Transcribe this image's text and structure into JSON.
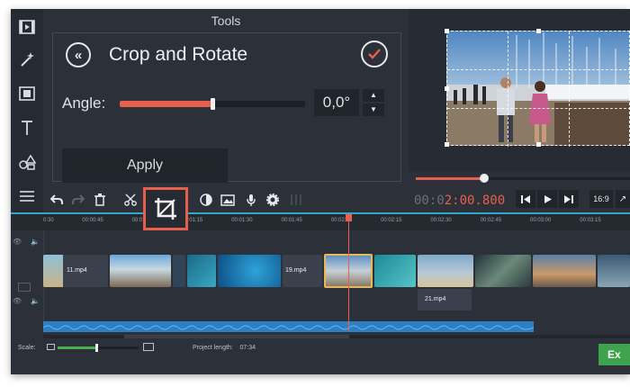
{
  "tools_panel": {
    "header": "Tools",
    "title": "Crop and Rotate",
    "back_icon": "chevron-double-left-icon",
    "confirm_icon": "check-icon",
    "angle_label": "Angle:",
    "angle_value": "0,0°",
    "angle_slider_fraction": 0.5,
    "apply_label": "Apply",
    "accent_color": "#e85f4e"
  },
  "sidebar": {
    "items": [
      {
        "icon": "film-import-icon"
      },
      {
        "icon": "magic-wand-icon"
      },
      {
        "icon": "transitions-icon"
      },
      {
        "icon": "titles-icon"
      },
      {
        "icon": "shapes-icon"
      },
      {
        "icon": "menu-icon"
      }
    ]
  },
  "preview": {
    "seek_fraction": 0.32
  },
  "toolbar": {
    "timecode_dim": "00:0",
    "timecode_active": "2:00.800",
    "aspect_label": "16:9",
    "export_icon": "export-icon"
  },
  "timeline": {
    "ticks": [
      "0:30",
      "00:00:45",
      "00:01:00",
      "00:01:15",
      "00:01:30",
      "00:01:45",
      "00:02:00",
      "00:02:15",
      "00:02:30",
      "00:02:45",
      "00:03:00",
      "00:03:15"
    ],
    "clips": [
      {
        "label": "11.mp4"
      },
      {
        "label": "19.mp4"
      },
      {
        "label": "21.mp4"
      }
    ],
    "audio_color": "#2f7fc4"
  },
  "status_bar": {
    "scale_label": "Scale:",
    "scale_fraction": 0.48,
    "project_length_label": "Project length:",
    "project_length_value": "07:34",
    "export_label": "Ex",
    "export_color": "#3fa34d"
  }
}
